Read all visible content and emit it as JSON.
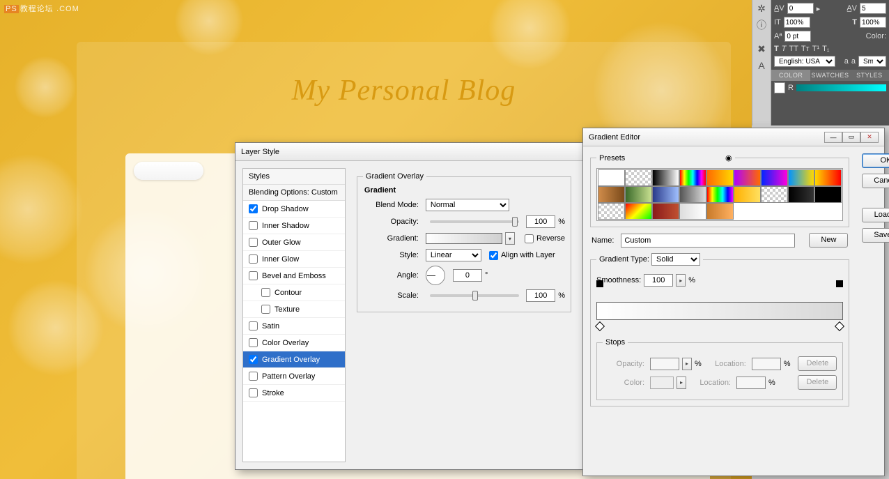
{
  "watermark": "教程论坛",
  "watermark_url": ".COM",
  "canvas": {
    "blog_title": "My Personal Blog"
  },
  "char_panel": {
    "av_left": "0",
    "av_right": "5",
    "scale_h": "100%",
    "scale_v": "100%",
    "baseline": "0 pt",
    "color_label": "Color:",
    "lang": "English: USA",
    "aa": "Smoo"
  },
  "color_tabs": {
    "t1": "COLOR",
    "t2": "SWATCHES",
    "t3": "STYLES",
    "channel": "R"
  },
  "layer_style": {
    "title": "Layer Style",
    "list_header": "Styles",
    "blending": "Blending Options: Custom",
    "items": [
      {
        "label": "Drop Shadow",
        "checked": true
      },
      {
        "label": "Inner Shadow",
        "checked": false
      },
      {
        "label": "Outer Glow",
        "checked": false
      },
      {
        "label": "Inner Glow",
        "checked": false
      },
      {
        "label": "Bevel and Emboss",
        "checked": false
      },
      {
        "label": "Contour",
        "checked": false,
        "sub": true
      },
      {
        "label": "Texture",
        "checked": false,
        "sub": true
      },
      {
        "label": "Satin",
        "checked": false
      },
      {
        "label": "Color Overlay",
        "checked": false
      },
      {
        "label": "Gradient Overlay",
        "checked": true,
        "selected": true
      },
      {
        "label": "Pattern Overlay",
        "checked": false
      },
      {
        "label": "Stroke",
        "checked": false
      }
    ],
    "section": "Gradient Overlay",
    "subsection": "Gradient",
    "blend_mode_label": "Blend Mode:",
    "blend_mode": "Normal",
    "opacity_label": "Opacity:",
    "opacity": "100",
    "pct": "%",
    "gradient_label": "Gradient:",
    "reverse": "Reverse",
    "style_label": "Style:",
    "style": "Linear",
    "align": "Align with Layer",
    "angle_label": "Angle:",
    "angle": "0",
    "deg": "°",
    "scale_label": "Scale:",
    "scale": "100"
  },
  "gradient_editor": {
    "title": "Gradient Editor",
    "presets_label": "Presets",
    "buttons": {
      "ok": "OK",
      "cancel": "Cancel",
      "load": "Load...",
      "save": "Save...",
      "new": "New"
    },
    "name_label": "Name:",
    "name": "Custom",
    "type_label": "Gradient Type:",
    "type": "Solid",
    "smooth_label": "Smoothness:",
    "smooth": "100",
    "pct": "%",
    "stops_label": "Stops",
    "stops": {
      "opacity": "Opacity:",
      "location": "Location:",
      "color": "Color:",
      "delete": "Delete"
    },
    "swatches": [
      "#ffffff",
      "repeating-conic-gradient(#ccc 0 25%,#fff 0 50%) 0/8px 8px",
      "linear-gradient(90deg,#000,#fff)",
      "linear-gradient(90deg,red,yellow,lime,cyan,blue,magenta,red)",
      "linear-gradient(90deg,#ff6a00,#ffd800)",
      "linear-gradient(90deg,#b000ff,#ff6a00)",
      "linear-gradient(90deg,#0026ff,#ff00dc)",
      "linear-gradient(90deg,#0094ff,#ffd800)",
      "linear-gradient(90deg,#ffd800,#ff0000)",
      "linear-gradient(90deg,#d08c4a,#7a4a1a)",
      "linear-gradient(90deg,#3a6a2a,#c8e090)",
      "linear-gradient(90deg,#2a3a8a,#a0c0ff)",
      "linear-gradient(90deg,#555,#ddd)",
      "linear-gradient(90deg,red,yellow,lime,cyan,blue,magenta)",
      "linear-gradient(90deg,#ffb000,#ffe060)",
      "repeating-conic-gradient(#ccc 0 25%,#fff 0 50%) 0/8px 8px",
      "linear-gradient(90deg,#000,#333)",
      "#000000",
      "repeating-conic-gradient(#ccc 0 25%,#fff 0 50%) 0/8px 8px",
      "linear-gradient(135deg,red,yellow,lime)",
      "linear-gradient(90deg,#8a1a1a,#c05030)",
      "linear-gradient(90deg,#ddd,#fff)",
      "linear-gradient(90deg,#c87a2a,#ffb060)"
    ]
  }
}
